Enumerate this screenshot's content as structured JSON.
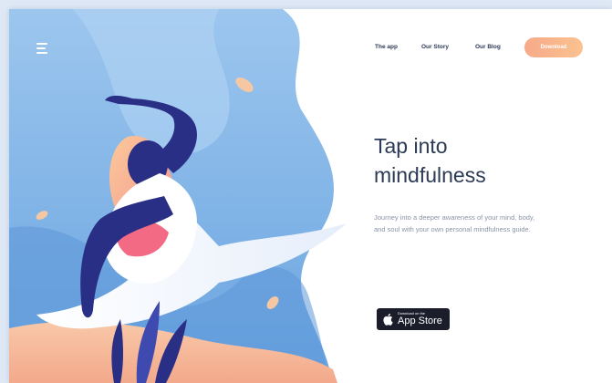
{
  "nav": {
    "items": [
      {
        "label": "The app"
      },
      {
        "label": "Our Story"
      },
      {
        "label": "Our Blog"
      }
    ],
    "download_label": "Download"
  },
  "hero": {
    "headline_line1": "Tap into",
    "headline_line2": "mindfulness",
    "subtext": "Journey into a deeper awareness of your mind, body, and soul with your own personal mindfulness guide."
  },
  "appstore": {
    "small_text": "Download on the",
    "big_text": "App Store"
  },
  "icons": {
    "menu": "hamburger-menu-icon",
    "apple": "apple-icon"
  },
  "colors": {
    "accent_from": "#f7a98a",
    "accent_to": "#fbc28e",
    "heading": "#2b3a55",
    "figure_navy": "#2a2f86",
    "sky_blue": "#7fb2e5"
  }
}
